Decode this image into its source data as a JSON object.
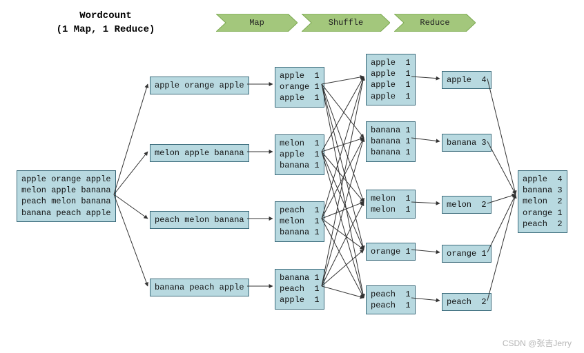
{
  "title_line1": "Wordcount",
  "title_line2": "(1 Map, 1 Reduce)",
  "chevrons": {
    "map": "Map",
    "shuffle": "Shuffle",
    "reduce": "Reduce"
  },
  "input": "apple orange apple\nmelon apple banana\npeach melon banana\nbanana peach apple",
  "split": [
    "apple orange apple",
    "melon apple banana",
    "peach melon banana",
    "banana peach apple"
  ],
  "map": [
    "apple  1\norange 1\napple  1",
    "melon  1\napple  1\nbanana 1",
    "peach  1\nmelon  1\nbanana 1",
    "banana 1\npeach  1\napple  1"
  ],
  "shuffle": [
    "apple  1\napple  1\napple  1\napple  1",
    "banana 1\nbanana 1\nbanana 1",
    "melon  1\nmelon  1",
    "orange 1",
    "peach  1\npeach  1"
  ],
  "reduce": [
    "apple  4",
    "banana 3",
    "melon  2",
    "orange 1",
    "peach  2"
  ],
  "output": "apple  4\nbanana 3\nmelon  2\norange 1\npeach  2",
  "watermark": "CSDN @张吉Jerry",
  "chart_data": {
    "type": "table",
    "title": "Wordcount (1 Map, 1 Reduce) — MapReduce flow",
    "stages": [
      "Map",
      "Shuffle",
      "Reduce"
    ],
    "input_lines": [
      "apple orange apple",
      "melon apple banana",
      "peach melon banana",
      "banana peach apple"
    ],
    "map_output": [
      [
        [
          "apple",
          1
        ],
        [
          "orange",
          1
        ],
        [
          "apple",
          1
        ]
      ],
      [
        [
          "melon",
          1
        ],
        [
          "apple",
          1
        ],
        [
          "banana",
          1
        ]
      ],
      [
        [
          "peach",
          1
        ],
        [
          "melon",
          1
        ],
        [
          "banana",
          1
        ]
      ],
      [
        [
          "banana",
          1
        ],
        [
          "peach",
          1
        ],
        [
          "apple",
          1
        ]
      ]
    ],
    "shuffle_groups": {
      "apple": [
        1,
        1,
        1,
        1
      ],
      "banana": [
        1,
        1,
        1
      ],
      "melon": [
        1,
        1
      ],
      "orange": [
        1
      ],
      "peach": [
        1,
        1
      ]
    },
    "reduce_output": {
      "apple": 4,
      "banana": 3,
      "melon": 2,
      "orange": 1,
      "peach": 2
    }
  }
}
